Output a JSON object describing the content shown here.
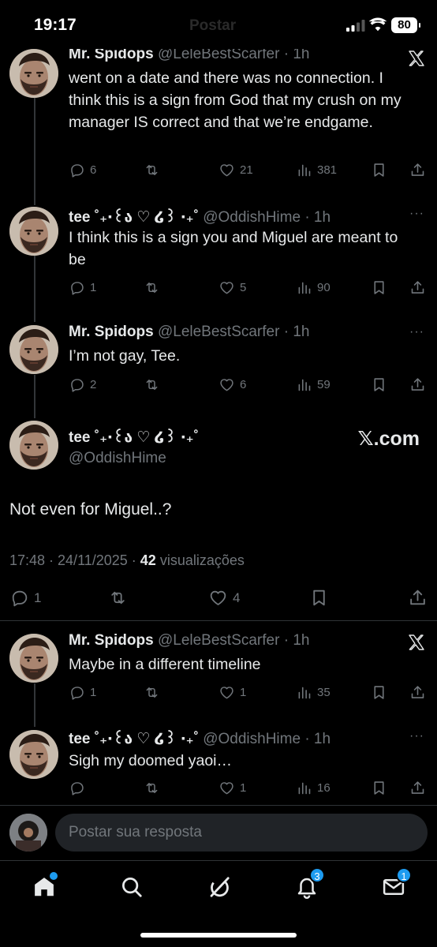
{
  "status_bar": {
    "time": "19:17",
    "ghost_title": "Postar",
    "battery": "80"
  },
  "posts": [
    {
      "name": "Mr. Spidops",
      "handle_time": "@LeleBestScarfer · 1h",
      "text": "went on a date and there was no connection. I think this is a sign from God that my crush on my manager IS correct and that we’re endgame.",
      "replies": "6",
      "reposts": "",
      "likes": "21",
      "views": "381"
    },
    {
      "name": "tee ˚₊‧꒰ა ♡ ໒꒱ ‧₊˚",
      "handle_time": "@OddishHime · 1h",
      "text": "I think this is a sign you and Miguel are meant to be",
      "replies": "1",
      "reposts": "",
      "likes": "5",
      "views": "90",
      "more": "···"
    },
    {
      "name": "Mr. Spidops",
      "handle_time": "@LeleBestScarfer · 1h",
      "text": "I’m not gay, Tee.",
      "replies": "2",
      "reposts": "",
      "likes": "6",
      "views": "59",
      "more": "···"
    }
  ],
  "focused": {
    "name": "tee ˚₊‧꒰ა ♡ ໒꒱ ‧₊˚",
    "handle": "@OddishHime",
    "watermark": "𝕏.com",
    "text": "Not even for Miguel..?",
    "timestamp": "17:48 · 24/11/2025 · ",
    "views_count": "42",
    "views_label": " visualizações",
    "replies": "1",
    "likes": "4"
  },
  "replies": [
    {
      "name": "Mr. Spidops",
      "handle_time": "@LeleBestScarfer · 1h",
      "text": "Maybe in a different timeline",
      "replies": "1",
      "likes": "1",
      "views": "35"
    },
    {
      "name": "tee ˚₊‧꒰ა ♡ ໒꒱ ‧₊˚",
      "handle_time": "@OddishHime · 1h",
      "text": "Sigh my doomed yaoi…",
      "replies": "",
      "likes": "1",
      "views": "16",
      "more": "···"
    }
  ],
  "reply_box": {
    "placeholder": "Postar sua resposta"
  },
  "tab_bar": {
    "notifications_badge": "3",
    "messages_badge": "1"
  },
  "icons": [
    "home-icon",
    "search-icon",
    "grok-icon",
    "bell-icon",
    "mail-icon",
    "reply-icon",
    "repost-icon",
    "like-icon",
    "views-icon",
    "bookmark-icon",
    "share-icon",
    "x-logo-icon"
  ],
  "colors": {
    "background": "#000000",
    "text": "#e7e9ea",
    "muted": "#71767b",
    "accent": "#1d9bf0",
    "divider": "#2f3336"
  }
}
